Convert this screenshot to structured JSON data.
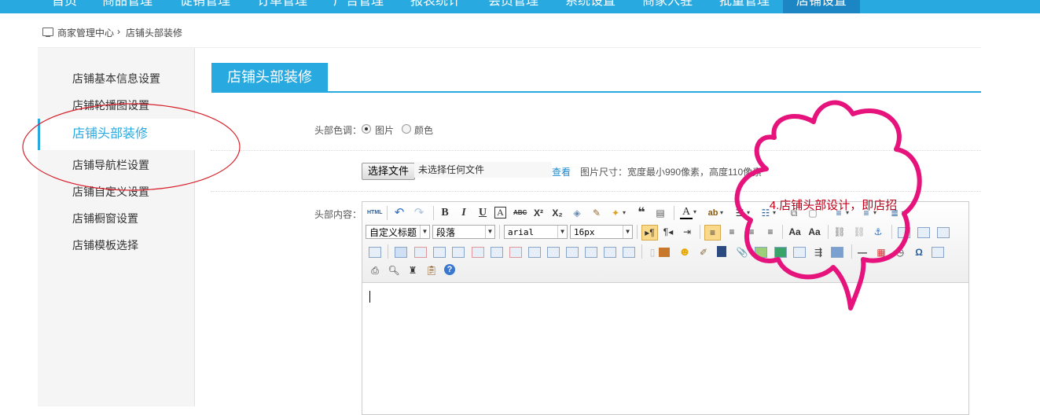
{
  "topnav": {
    "items": [
      "首页",
      "商品管理",
      "促销管理",
      "订单管理",
      "广告管理",
      "报表统计",
      "会员管理",
      "系统设置",
      "商家入驻",
      "批量管理",
      "店铺设置"
    ],
    "active": "店铺设置"
  },
  "breadcrumb": {
    "root": "商家管理中心",
    "separator": "›",
    "current": "店铺头部装修",
    "icon": "monitor-icon"
  },
  "sidebar": {
    "items": [
      {
        "label": "店铺基本信息设置"
      },
      {
        "label": "店铺轮播图设置"
      },
      {
        "label": "店铺头部装修",
        "active": true
      },
      {
        "label": "店铺导航栏设置"
      },
      {
        "label": "店铺自定义设置"
      },
      {
        "label": "店铺橱窗设置"
      },
      {
        "label": "店铺模板选择"
      }
    ]
  },
  "main": {
    "title": "店铺头部装修",
    "header_tone": {
      "label": "头部色调：",
      "options": [
        "图片",
        "颜色"
      ],
      "selected": "图片"
    },
    "upload": {
      "button": "选择文件",
      "filename": "未选择任何文件",
      "view_link": "查看",
      "hint": "图片尺寸：宽度最小990像素，高度110像素"
    },
    "content_label": "头部内容：",
    "editor": {
      "heading_select": "自定义标题",
      "paragraph_select": "段落",
      "font_select": "arial",
      "size_select": "16px",
      "row1_icons": [
        "html-source-icon",
        "undo-icon",
        "redo-icon",
        "bold-icon",
        "italic-icon",
        "underline-icon",
        "font-border-icon",
        "strikethrough-icon",
        "superscript-icon",
        "subscript-icon",
        "eraser-icon",
        "format-brush-icon",
        "auto-format-icon",
        "blockquote-icon",
        "paste-text-icon",
        "font-color-icon",
        "background-color-icon",
        "ordered-list-icon",
        "unordered-list-icon",
        "select-all-icon",
        "clear-doc-icon",
        "row-spacing-top-icon",
        "row-spacing-bottom-icon",
        "line-height-icon"
      ],
      "row2_icons": [
        "ltr-icon",
        "rtl-icon",
        "indent-icon",
        "align-left-icon",
        "align-center-icon",
        "align-right-icon",
        "justify-icon",
        "uppercase-icon",
        "lowercase-icon",
        "link-icon",
        "unlink-icon",
        "anchor-icon",
        "image-none-icon",
        "image-left-icon",
        "image-right-icon"
      ],
      "row3_icons": [
        "image-center-icon",
        "insert-table-icon",
        "delete-table-icon",
        "insert-paragraph-before-table-icon",
        "insert-row-icon",
        "delete-row-icon",
        "insert-col-icon",
        "delete-col-icon",
        "merge-cells-icon",
        "merge-right-icon",
        "merge-down-icon",
        "split-cells-icon",
        "split-rows-icon",
        "split-cols-icon",
        "simple-upload-icon",
        "insert-image-icon",
        "emotion-icon",
        "scrawl-icon",
        "insert-video-icon",
        "attachment-icon",
        "insert-frame-icon",
        "code-icon",
        "page-break-icon",
        "template-icon",
        "background-icon",
        "horizontal-line-icon",
        "date-icon",
        "time-icon",
        "special-chars-icon",
        "word-image-icon"
      ],
      "row4_icons": [
        "print-icon",
        "preview-icon",
        "search-replace-icon",
        "paste-icon",
        "help-icon"
      ]
    }
  },
  "annotation": {
    "text": "4.店铺头部设计，即店招",
    "color": "#c0001b",
    "cloud_color": "#e5137b",
    "ellipse_color": "#d8202a"
  },
  "colors": {
    "accent": "#28a9e0",
    "nav_active": "#1c86c4"
  }
}
